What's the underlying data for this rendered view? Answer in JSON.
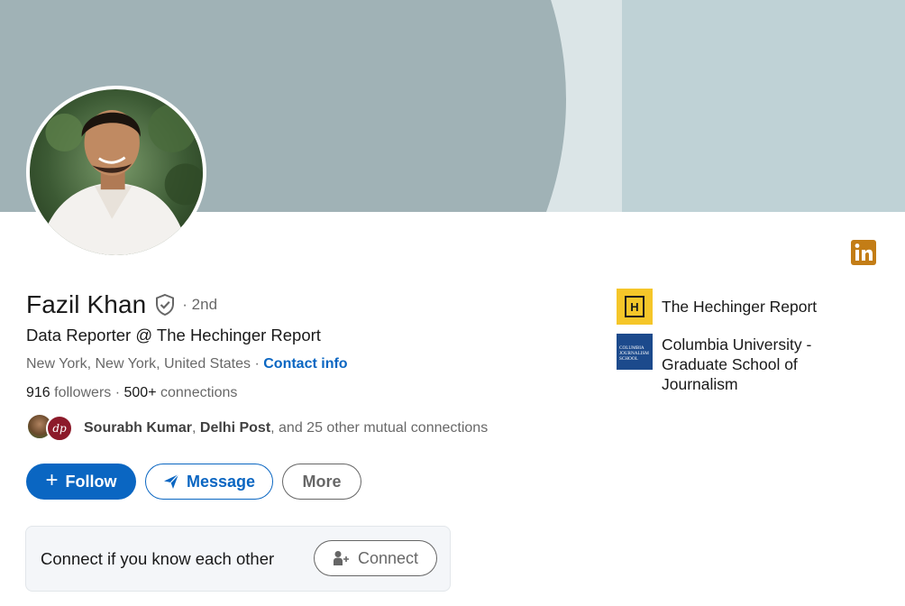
{
  "profile": {
    "name": "Fazil Khan",
    "degree": "· 2nd",
    "headline": "Data Reporter @ The Hechinger Report",
    "location": "New York, New York, United States",
    "location_separator": " · ",
    "contact_info_label": "Contact info",
    "followers_count": "916",
    "followers_label": " followers",
    "connections_separator": " · ",
    "connections_count": "500+",
    "connections_label": " connections"
  },
  "mutual": {
    "name1": "Sourabh Kumar",
    "sep1": ", ",
    "name2": "Delhi Post",
    "rest": ", and 25 other mutual connections",
    "avatar2_text": "dp"
  },
  "actions": {
    "follow_label": "Follow",
    "follow_icon": "+",
    "message_label": "Message",
    "more_label": "More"
  },
  "connect_card": {
    "text": "Connect if you know each other",
    "button_label": "Connect"
  },
  "experience": {
    "company": "The Hechinger Report",
    "company_logo_letter": "H"
  },
  "education": {
    "school": "Columbia University - Graduate School of Journalism",
    "school_logo_text": "COLUMBIA JOURNALISM SCHOOL"
  },
  "colors": {
    "primary": "#0a66c2",
    "banner_shape": "#a0b2b6",
    "banner_mid": "#dbe5e7",
    "banner_right": "#bfd2d6",
    "linkedin_badge": "#c37d16",
    "hechinger_logo": "#f5c629",
    "columbia_logo": "#1c4a8c"
  },
  "icons": {
    "verify": "shield-check-icon",
    "linkedin": "linkedin-logo-icon",
    "message": "paper-plane-icon",
    "connect": "person-add-icon"
  }
}
